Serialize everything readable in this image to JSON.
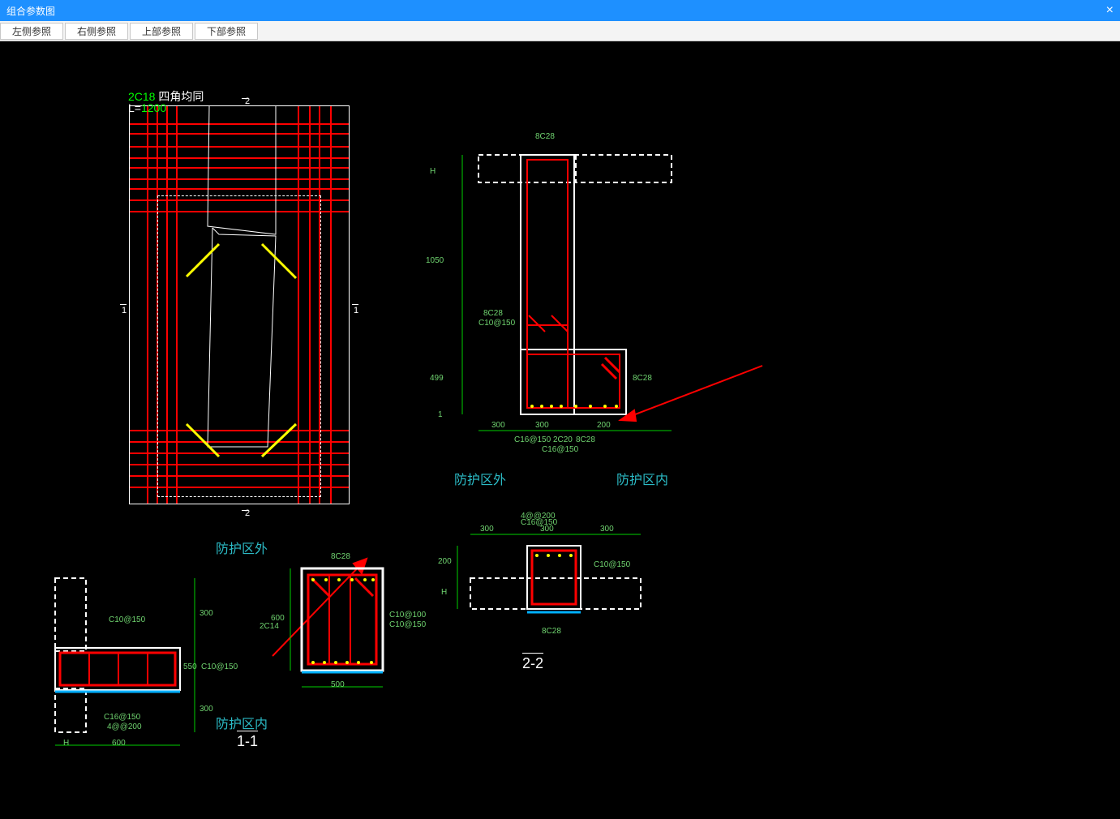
{
  "app": {
    "title": "组合参数图"
  },
  "toolbar": {
    "left_ref": "左侧参照",
    "right_ref": "右侧参照",
    "top_ref": "上部参照",
    "bottom_ref": "下部参照"
  },
  "plan": {
    "corner_bar": "2C18",
    "corner_note": "四角均同",
    "len_prefix": "L=",
    "len_val": "1200",
    "cut_top": "2",
    "cut_bottom": "2",
    "cut_left": "1",
    "cut_right": "1"
  },
  "sec_upper": {
    "dim_1050": "1050",
    "dim_499": "499",
    "dim_H": "H",
    "dim_1": "1",
    "dim_300l": "300",
    "dim_300c": "300",
    "dim_200": "200",
    "bar_g_top": "8C28",
    "bar_g_l1": "8C28",
    "bar_g_l2": "C10@150",
    "bar_g_r": "8C28",
    "bar_g_bot1": "C16@150 2C20",
    "bar_g_bot2": "8C28",
    "bar_g_bottom": "C16@150"
  },
  "labels": {
    "outside_1": "防护区外",
    "inside_1": "防护区内",
    "outside_2": "防护区外",
    "inside_2": "防护区内",
    "section_1": "1-1",
    "section_2": "2-2"
  },
  "sec_1a": {
    "dim_300t": "300",
    "dim_300b": "300",
    "dim_550": "550",
    "dim_H": "H",
    "dim_600": "600",
    "bar_top": "C10@150",
    "bar_mid": "C10@150",
    "bar_bot1": "C16@150",
    "bar_bot2": "4@@200"
  },
  "sec_1b": {
    "dim_600": "600",
    "dim_500": "500",
    "bar_top": "8C28",
    "bar_side": "2C14",
    "bar_r1": "C10@100",
    "bar_r2": "C10@150"
  },
  "sec_22": {
    "dim_300l": "300",
    "dim_300c": "300",
    "dim_300r": "300",
    "dim_200": "200",
    "dim_H": "H",
    "bar_top1": "4@@200",
    "bar_top2": "C16@150",
    "bar_r": "C10@150",
    "bar_bot": "8C28"
  }
}
